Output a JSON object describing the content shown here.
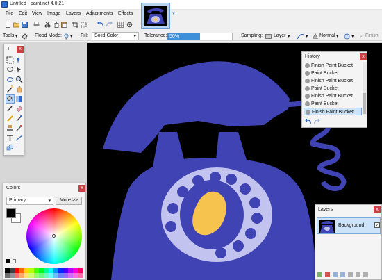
{
  "window": {
    "title": "Untitled - paint.net 4.0.21"
  },
  "menu": [
    "File",
    "Edit",
    "View",
    "Image",
    "Layers",
    "Adjustments",
    "Effects"
  ],
  "options": {
    "tools_label": "Tools",
    "flood_mode_label": "Flood Mode:",
    "fill_label": "Fill:",
    "fill_value": "Solid Color",
    "tolerance_label": "Tolerance:",
    "tolerance_value": "50%",
    "tolerance_fraction": 0.5,
    "sampling_label": "Sampling:",
    "sampling_value": "Layer",
    "blend_value": "Normal",
    "finish_label": "Finish"
  },
  "history": {
    "title": "History",
    "items": [
      "Finish Paint Bucket",
      "Paint Bucket",
      "Finish Paint Bucket",
      "Paint Bucket",
      "Finish Paint Bucket",
      "Paint Bucket",
      "Finish Paint Bucket"
    ]
  },
  "colors": {
    "title": "Colors",
    "mode": "Primary",
    "more_label": "More >>",
    "primary": "#000000",
    "secondary": "#ffffff",
    "palette": [
      "#000000",
      "#404040",
      "#ff0000",
      "#ff6a00",
      "#ffd800",
      "#b6ff00",
      "#4cff00",
      "#00ff21",
      "#00ff90",
      "#00ffff",
      "#0094ff",
      "#0026ff",
      "#4800ff",
      "#b200ff",
      "#ff00dc",
      "#ff006e"
    ]
  },
  "layers": {
    "title": "Layers",
    "items": [
      {
        "name": "Background",
        "visible": true
      }
    ]
  },
  "canvas": {
    "background": "#000000",
    "phone_blue": "#3f43b3",
    "dial_light": "#c3c3f0",
    "center_yellow": "#f7c34f"
  },
  "tools_win": {
    "title": "T"
  }
}
